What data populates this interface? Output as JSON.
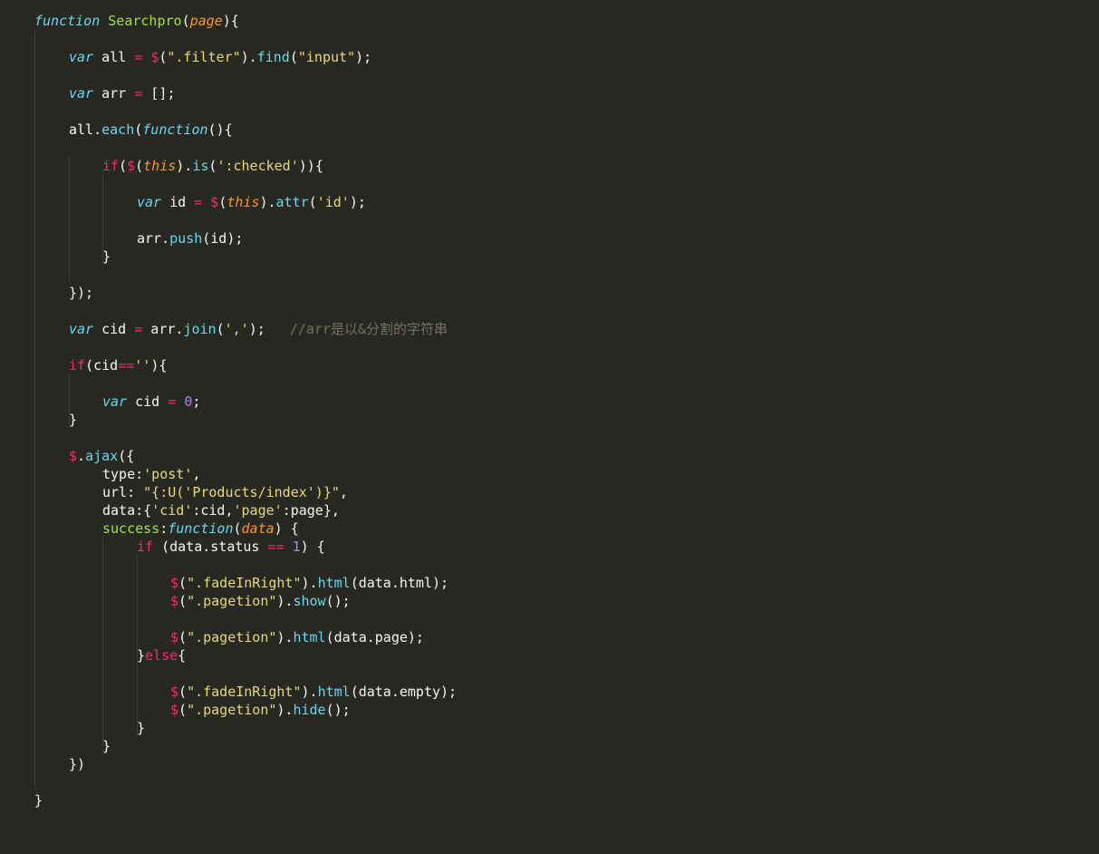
{
  "editor": {
    "language": "javascript",
    "theme": "monokai",
    "colors": {
      "background": "#272822",
      "text": "#f8f8f2",
      "keyword": "#f92672",
      "storage": "#66d9ef",
      "function_name": "#a6e22e",
      "string": "#e6db74",
      "number": "#ae81ff",
      "parameter": "#fd971f",
      "comment": "#75715e",
      "indent_guide": "#3b3c35"
    },
    "lines": [
      [
        [
          "st",
          "function"
        ],
        [
          "p",
          " "
        ],
        [
          "fn",
          "Searchpro"
        ],
        [
          "p",
          "("
        ],
        [
          "prm",
          "page"
        ],
        [
          "p",
          "){"
        ]
      ],
      [],
      [
        [
          "st",
          "var"
        ],
        [
          "p",
          " all "
        ],
        [
          "op",
          "="
        ],
        [
          "p",
          " "
        ],
        [
          "dl",
          "$"
        ],
        [
          "p",
          "("
        ],
        [
          "str",
          "\".filter\""
        ],
        [
          "p",
          ")."
        ],
        [
          "mt",
          "find"
        ],
        [
          "p",
          "("
        ],
        [
          "str",
          "\"input\""
        ],
        [
          "p",
          ");"
        ]
      ],
      [],
      [
        [
          "st",
          "var"
        ],
        [
          "p",
          " arr "
        ],
        [
          "op",
          "="
        ],
        [
          "p",
          " [];"
        ]
      ],
      [],
      [
        [
          "p",
          "all."
        ],
        [
          "mt",
          "each"
        ],
        [
          "p",
          "("
        ],
        [
          "st",
          "function"
        ],
        [
          "p",
          "(){"
        ]
      ],
      [],
      [
        [
          "kw",
          "if"
        ],
        [
          "p",
          "("
        ],
        [
          "dl",
          "$"
        ],
        [
          "p",
          "("
        ],
        [
          "prm",
          "this"
        ],
        [
          "p",
          ")."
        ],
        [
          "mt",
          "is"
        ],
        [
          "p",
          "("
        ],
        [
          "str",
          "':checked'"
        ],
        [
          "p",
          "))"
        ],
        [
          "p",
          "{"
        ]
      ],
      [],
      [
        [
          "st",
          "var"
        ],
        [
          "p",
          " id "
        ],
        [
          "op",
          "="
        ],
        [
          "p",
          " "
        ],
        [
          "dl",
          "$"
        ],
        [
          "p",
          "("
        ],
        [
          "prm",
          "this"
        ],
        [
          "p",
          ")."
        ],
        [
          "mt",
          "attr"
        ],
        [
          "p",
          "("
        ],
        [
          "str",
          "'id'"
        ],
        [
          "p",
          ");"
        ]
      ],
      [],
      [
        [
          "p",
          "arr."
        ],
        [
          "mt",
          "push"
        ],
        [
          "p",
          "(id);"
        ]
      ],
      [
        [
          "p",
          "}"
        ]
      ],
      [],
      [
        [
          "p",
          "});"
        ]
      ],
      [],
      [
        [
          "st",
          "var"
        ],
        [
          "p",
          " cid "
        ],
        [
          "op",
          "="
        ],
        [
          "p",
          " arr."
        ],
        [
          "mt",
          "join"
        ],
        [
          "p",
          "("
        ],
        [
          "str",
          "','"
        ],
        [
          "p",
          ");   "
        ],
        [
          "cm",
          "//arr是以&分割的字符串"
        ]
      ],
      [],
      [
        [
          "kw",
          "if"
        ],
        [
          "p",
          "(cid"
        ],
        [
          "op",
          "=="
        ],
        [
          "str",
          "''"
        ],
        [
          "p",
          "){"
        ]
      ],
      [],
      [
        [
          "st",
          "var"
        ],
        [
          "p",
          " cid "
        ],
        [
          "op",
          "="
        ],
        [
          "p",
          " "
        ],
        [
          "num",
          "0"
        ],
        [
          "p",
          ";"
        ]
      ],
      [
        [
          "p",
          "}"
        ]
      ],
      [],
      [
        [
          "dl",
          "$"
        ],
        [
          "p",
          "."
        ],
        [
          "mt",
          "ajax"
        ],
        [
          "p",
          "({"
        ]
      ],
      [
        [
          "p",
          "type:"
        ],
        [
          "str",
          "'post'"
        ],
        [
          "p",
          ","
        ]
      ],
      [
        [
          "p",
          "url: "
        ],
        [
          "str",
          "\"{:U('Products/index')}\""
        ],
        [
          "p",
          ","
        ]
      ],
      [
        [
          "p",
          "data:{"
        ],
        [
          "str",
          "'cid'"
        ],
        [
          "p",
          ":cid,"
        ],
        [
          "str",
          "'page'"
        ],
        [
          "p",
          ":page},"
        ]
      ],
      [
        [
          "fn",
          "success"
        ],
        [
          "p",
          ":"
        ],
        [
          "st",
          "function"
        ],
        [
          "p",
          "("
        ],
        [
          "prm",
          "data"
        ],
        [
          "p",
          ") {"
        ]
      ],
      [
        [
          "kw",
          "if"
        ],
        [
          "p",
          " (data.status "
        ],
        [
          "op",
          "=="
        ],
        [
          "p",
          " "
        ],
        [
          "num",
          "1"
        ],
        [
          "p",
          ") {"
        ]
      ],
      [],
      [
        [
          "dl",
          "$"
        ],
        [
          "p",
          "("
        ],
        [
          "str",
          "\".fadeInRight\""
        ],
        [
          "p",
          ")."
        ],
        [
          "mt",
          "html"
        ],
        [
          "p",
          "(data.html);"
        ]
      ],
      [
        [
          "dl",
          "$"
        ],
        [
          "p",
          "("
        ],
        [
          "str",
          "\".pagetion\""
        ],
        [
          "p",
          ")."
        ],
        [
          "mt",
          "show"
        ],
        [
          "p",
          "();"
        ]
      ],
      [],
      [
        [
          "dl",
          "$"
        ],
        [
          "p",
          "("
        ],
        [
          "str",
          "\".pagetion\""
        ],
        [
          "p",
          ")."
        ],
        [
          "mt",
          "html"
        ],
        [
          "p",
          "(data.page);"
        ]
      ],
      [
        [
          "p",
          "}"
        ],
        [
          "kw",
          "else"
        ],
        [
          "p",
          "{"
        ]
      ],
      [],
      [
        [
          "dl",
          "$"
        ],
        [
          "p",
          "("
        ],
        [
          "str",
          "\".fadeInRight\""
        ],
        [
          "p",
          ")."
        ],
        [
          "mt",
          "html"
        ],
        [
          "p",
          "(data.empty);"
        ]
      ],
      [
        [
          "dl",
          "$"
        ],
        [
          "p",
          "("
        ],
        [
          "str",
          "\".pagetion\""
        ],
        [
          "p",
          ")."
        ],
        [
          "mt",
          "hide"
        ],
        [
          "p",
          "();"
        ]
      ],
      [
        [
          "p",
          "}"
        ]
      ],
      [
        [
          "p",
          "}"
        ]
      ],
      [
        [
          "p",
          "})"
        ]
      ],
      [],
      [
        [
          "p",
          "}"
        ]
      ]
    ]
  }
}
